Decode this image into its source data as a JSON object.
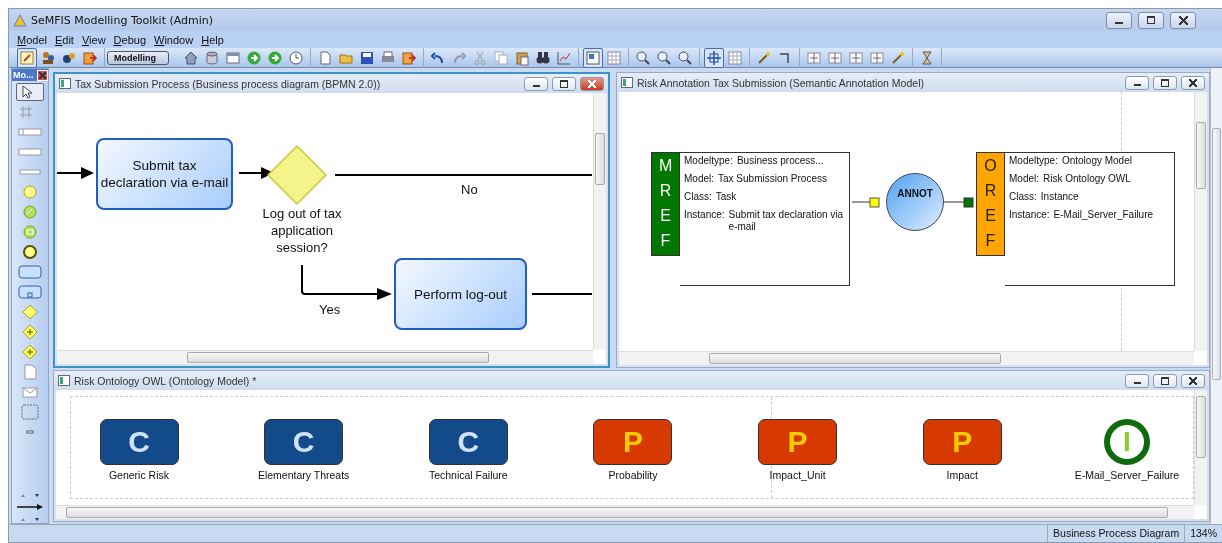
{
  "window": {
    "title": "SeMFIS Modelling Toolkit (Admin)"
  },
  "menu": [
    "Model",
    "Edit",
    "View",
    "Debug",
    "Window",
    "Help"
  ],
  "toolbar": {
    "mode_label": "Modelling",
    "toggles": [
      {
        "selected": true
      },
      {
        "selected": true
      },
      {
        "selected": false
      },
      {
        "selected": true
      },
      {
        "selected": false
      }
    ]
  },
  "palette": {
    "title": "Mo...",
    "tools": [
      {
        "kind": "pointer",
        "selected": true
      },
      {
        "kind": "grid",
        "selected": false
      },
      {
        "kind": "pool",
        "selected": false
      },
      {
        "kind": "lane",
        "selected": false
      },
      {
        "kind": "bar",
        "selected": false
      },
      {
        "kind": "start-event",
        "selected": false
      },
      {
        "kind": "timer-event",
        "selected": false
      },
      {
        "kind": "message-event",
        "selected": false
      },
      {
        "kind": "end-event",
        "selected": false
      },
      {
        "kind": "task",
        "selected": false
      },
      {
        "kind": "subprocess",
        "selected": false
      },
      {
        "kind": "gateway",
        "selected": false
      },
      {
        "kind": "parallel-gateway",
        "selected": false
      },
      {
        "kind": "inclusive-gateway",
        "selected": false
      },
      {
        "kind": "document",
        "selected": false
      },
      {
        "kind": "envelope",
        "selected": false
      },
      {
        "kind": "group",
        "selected": false
      },
      {
        "kind": "dash",
        "selected": false
      },
      {
        "kind": "dot",
        "selected": false
      }
    ]
  },
  "bpmn_window": {
    "title": "Tax Submission Process (Business process diagram (BPMN 2.0))",
    "active": true,
    "tasks": [
      "Submit tax declaration via e-mail",
      "Perform log-out"
    ],
    "gateway": "Log out of tax application session?",
    "no_label": "No",
    "yes_label": "Yes"
  },
  "annotation_window": {
    "title": "Risk Annotation Tax Submission (Semantic Annotation Model)",
    "active": false,
    "model_ref": {
      "letters": "MREF",
      "color": "#007700",
      "fields": [
        {
          "label": "Modeltype:",
          "value": "Business process..."
        },
        {
          "label": "Model:",
          "value": "Tax Submission Process"
        },
        {
          "label": "Class:",
          "value": "Task"
        },
        {
          "label": "Instance:",
          "value": "Submit tax declaration via e-mail"
        }
      ]
    },
    "annotation": "ANNOT",
    "ontology_ref": {
      "letters": "OREF",
      "color": "#ffa500",
      "fields": [
        {
          "label": "Modeltype:",
          "value": "Ontology Model"
        },
        {
          "label": "Model:",
          "value": "Risk Ontology OWL"
        },
        {
          "label": "Class:",
          "value": "Instance"
        },
        {
          "label": "Instance:",
          "value": "E-Mail_Server_Failure"
        }
      ]
    }
  },
  "ontology_window": {
    "title": "Risk Ontology OWL (Ontology Model) *",
    "active": false,
    "items": [
      {
        "kind": "class",
        "letter": "C",
        "label": "Generic Risk"
      },
      {
        "kind": "class",
        "letter": "C",
        "label": "Elementary Threats"
      },
      {
        "kind": "class",
        "letter": "C",
        "label": "Technical Failure"
      },
      {
        "kind": "property",
        "letter": "P",
        "label": "Probability"
      },
      {
        "kind": "property",
        "letter": "P",
        "label": "Impact_Unit"
      },
      {
        "kind": "property",
        "letter": "P",
        "label": "Impact"
      },
      {
        "kind": "instance",
        "letter": "I",
        "label": "E-Mail_Server_Failure"
      }
    ]
  },
  "status_bar": [
    "Business Process Diagram",
    "134%"
  ]
}
